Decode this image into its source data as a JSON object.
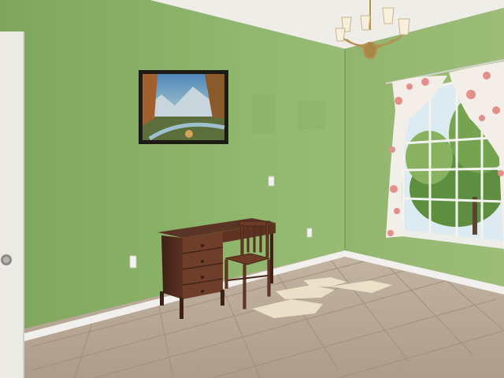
{
  "scene": {
    "colors": {
      "wall_left": "#8fb36a",
      "wall_right": "#95b871",
      "wall_shadow": "#7da35a",
      "ceiling": "#efeee9",
      "baseboard": "#f2f2ee",
      "floor": "#b9a996",
      "floor_grout": "#a29281",
      "door": "#ecebe6",
      "wood_dark": "#4a2a1c",
      "wood_mid": "#6b3b27",
      "brass": "#b8975a",
      "curtain": "#f4eee8",
      "curtain_floral": "#e6918c",
      "sunlight": "#f6ecd4",
      "foliage": "#6d9a4a",
      "sky": "#dfeef5"
    },
    "objects": [
      "wall-left",
      "wall-right",
      "ceiling",
      "chandelier",
      "framed-landscape-painting",
      "window-with-floral-curtains",
      "wooden-writing-desk",
      "wooden-chair",
      "tiled-floor",
      "white-door-edge",
      "light-switch",
      "wall-outlets"
    ]
  }
}
